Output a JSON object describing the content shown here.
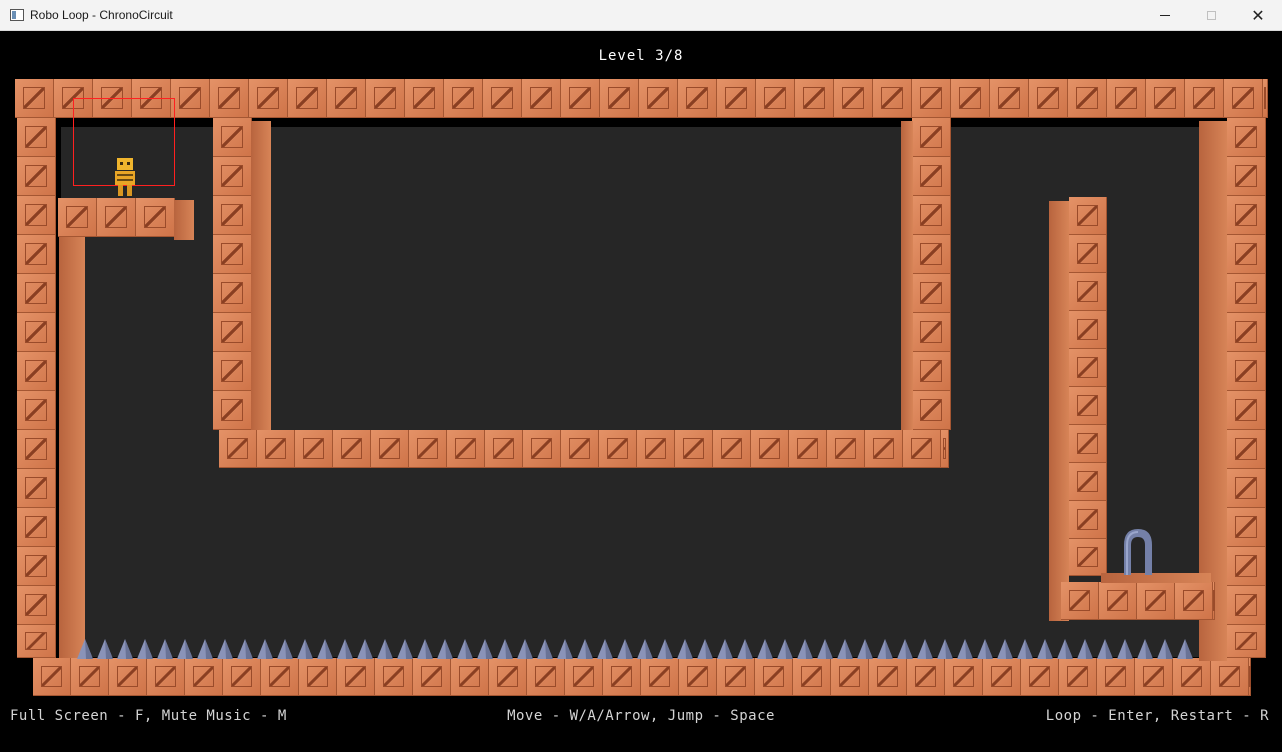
{
  "window": {
    "title": "Robo Loop - ChronoCircuit",
    "controls": [
      "minimize",
      "maximize",
      "close"
    ]
  },
  "hud": {
    "level": "Level 3/8"
  },
  "hints": {
    "left": "Full Screen - F, Mute Music - M",
    "center": "Move - W/A/Arrow, Jump - Space",
    "right": "Loop - Enter, Restart - R"
  },
  "colors": {
    "block": "#d87c50",
    "background": "#262626",
    "spikes": "#8a93b8",
    "player": "#f0b52d",
    "hitbox": "#ff2020",
    "portal": "#7480a8"
  },
  "icons": {
    "app": "window-app-icon",
    "player": "robot-player",
    "goal": "arch-portal",
    "hazard": "spike-row"
  }
}
